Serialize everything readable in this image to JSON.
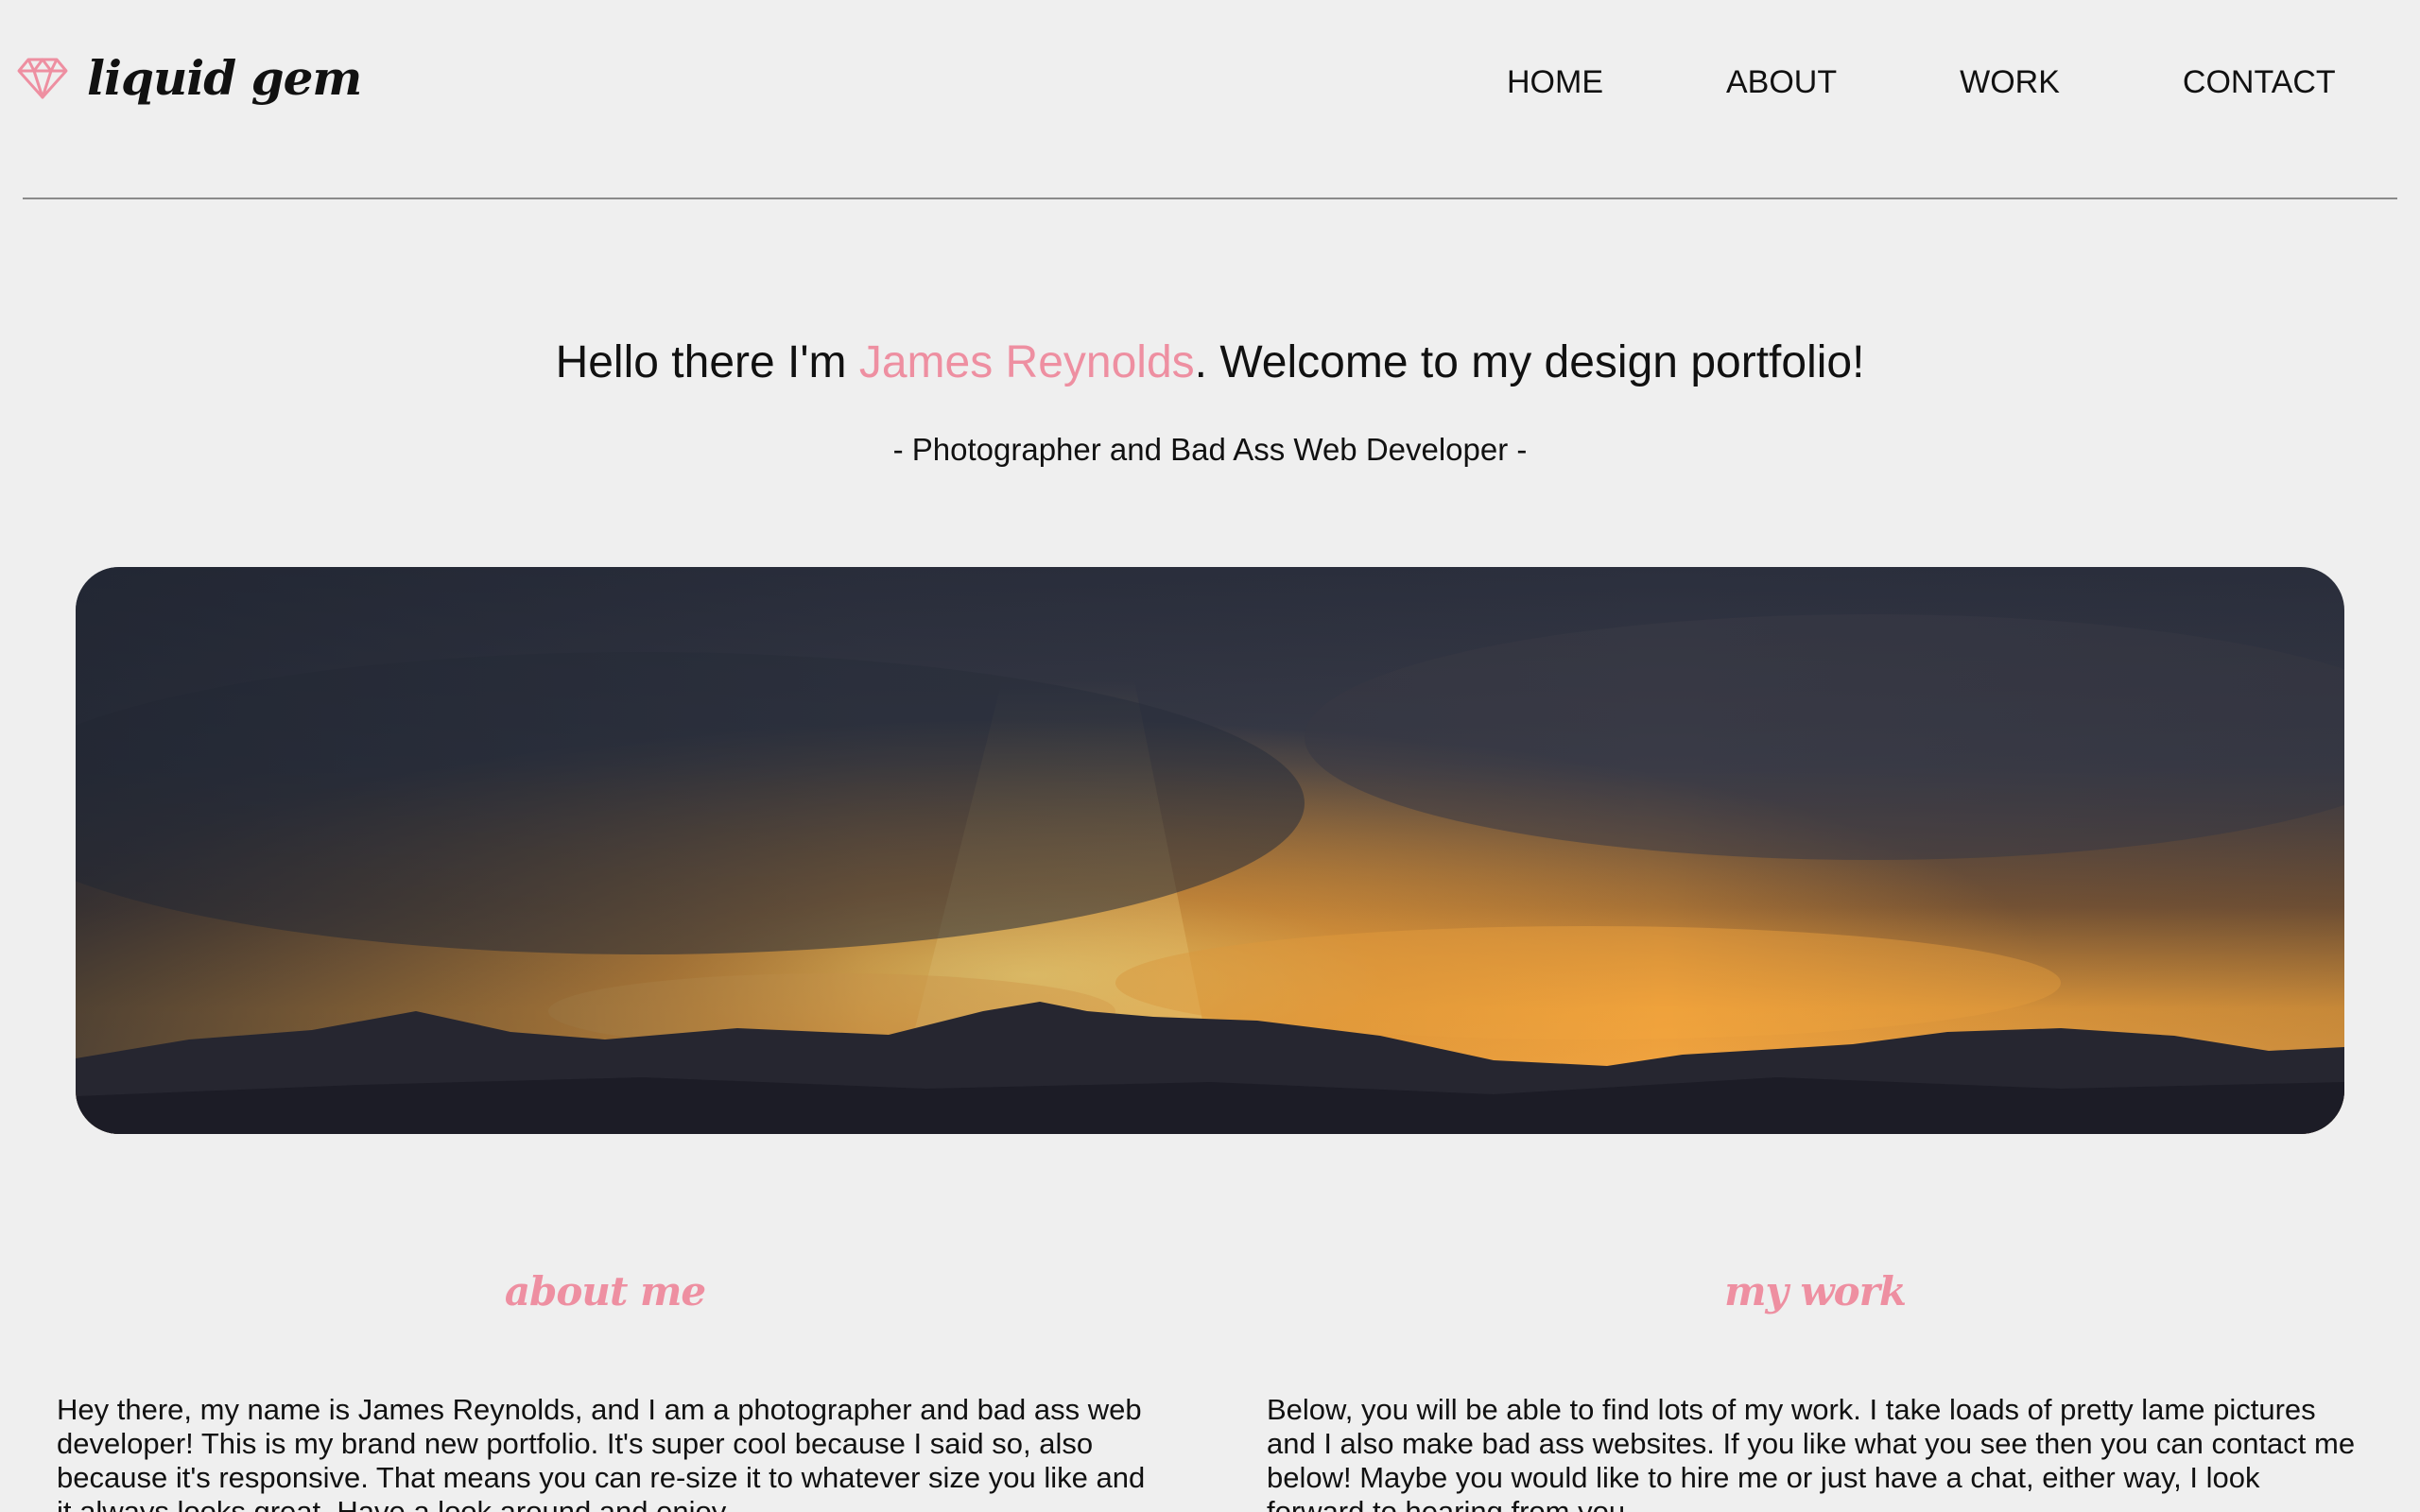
{
  "brand": {
    "name": "liquid gem",
    "icon": "diamond-icon",
    "accent_color": "#ee8fa1"
  },
  "nav": {
    "items": [
      {
        "label": "HOME"
      },
      {
        "label": "ABOUT"
      },
      {
        "label": "WORK"
      },
      {
        "label": "CONTACT"
      }
    ]
  },
  "hero": {
    "title_prefix": "Hello there I'm ",
    "name": "James Reynolds",
    "title_suffix": ". Welcome to my design portfolio!",
    "subtitle": "- Photographer and Bad Ass Web Developer -"
  },
  "banner": {
    "image": "sunset over mountains"
  },
  "about": {
    "heading": "about me",
    "body": "Hey there, my name is James Reynolds, and I am a photographer and bad ass web developer! This is my brand new portfolio. It's super cool because I said so, also because it's responsive. That means you can re-size it to whatever size you like and it always looks great. Have a look around and enjoy."
  },
  "work": {
    "heading": "my work",
    "body": "Below, you will be able to find lots of my work. I take loads of pretty lame pictures and I also make bad ass websites. If you like what you see then you can contact me below! Maybe you would like to hire me or just have a chat, either way, I look forward to hearing from you."
  }
}
